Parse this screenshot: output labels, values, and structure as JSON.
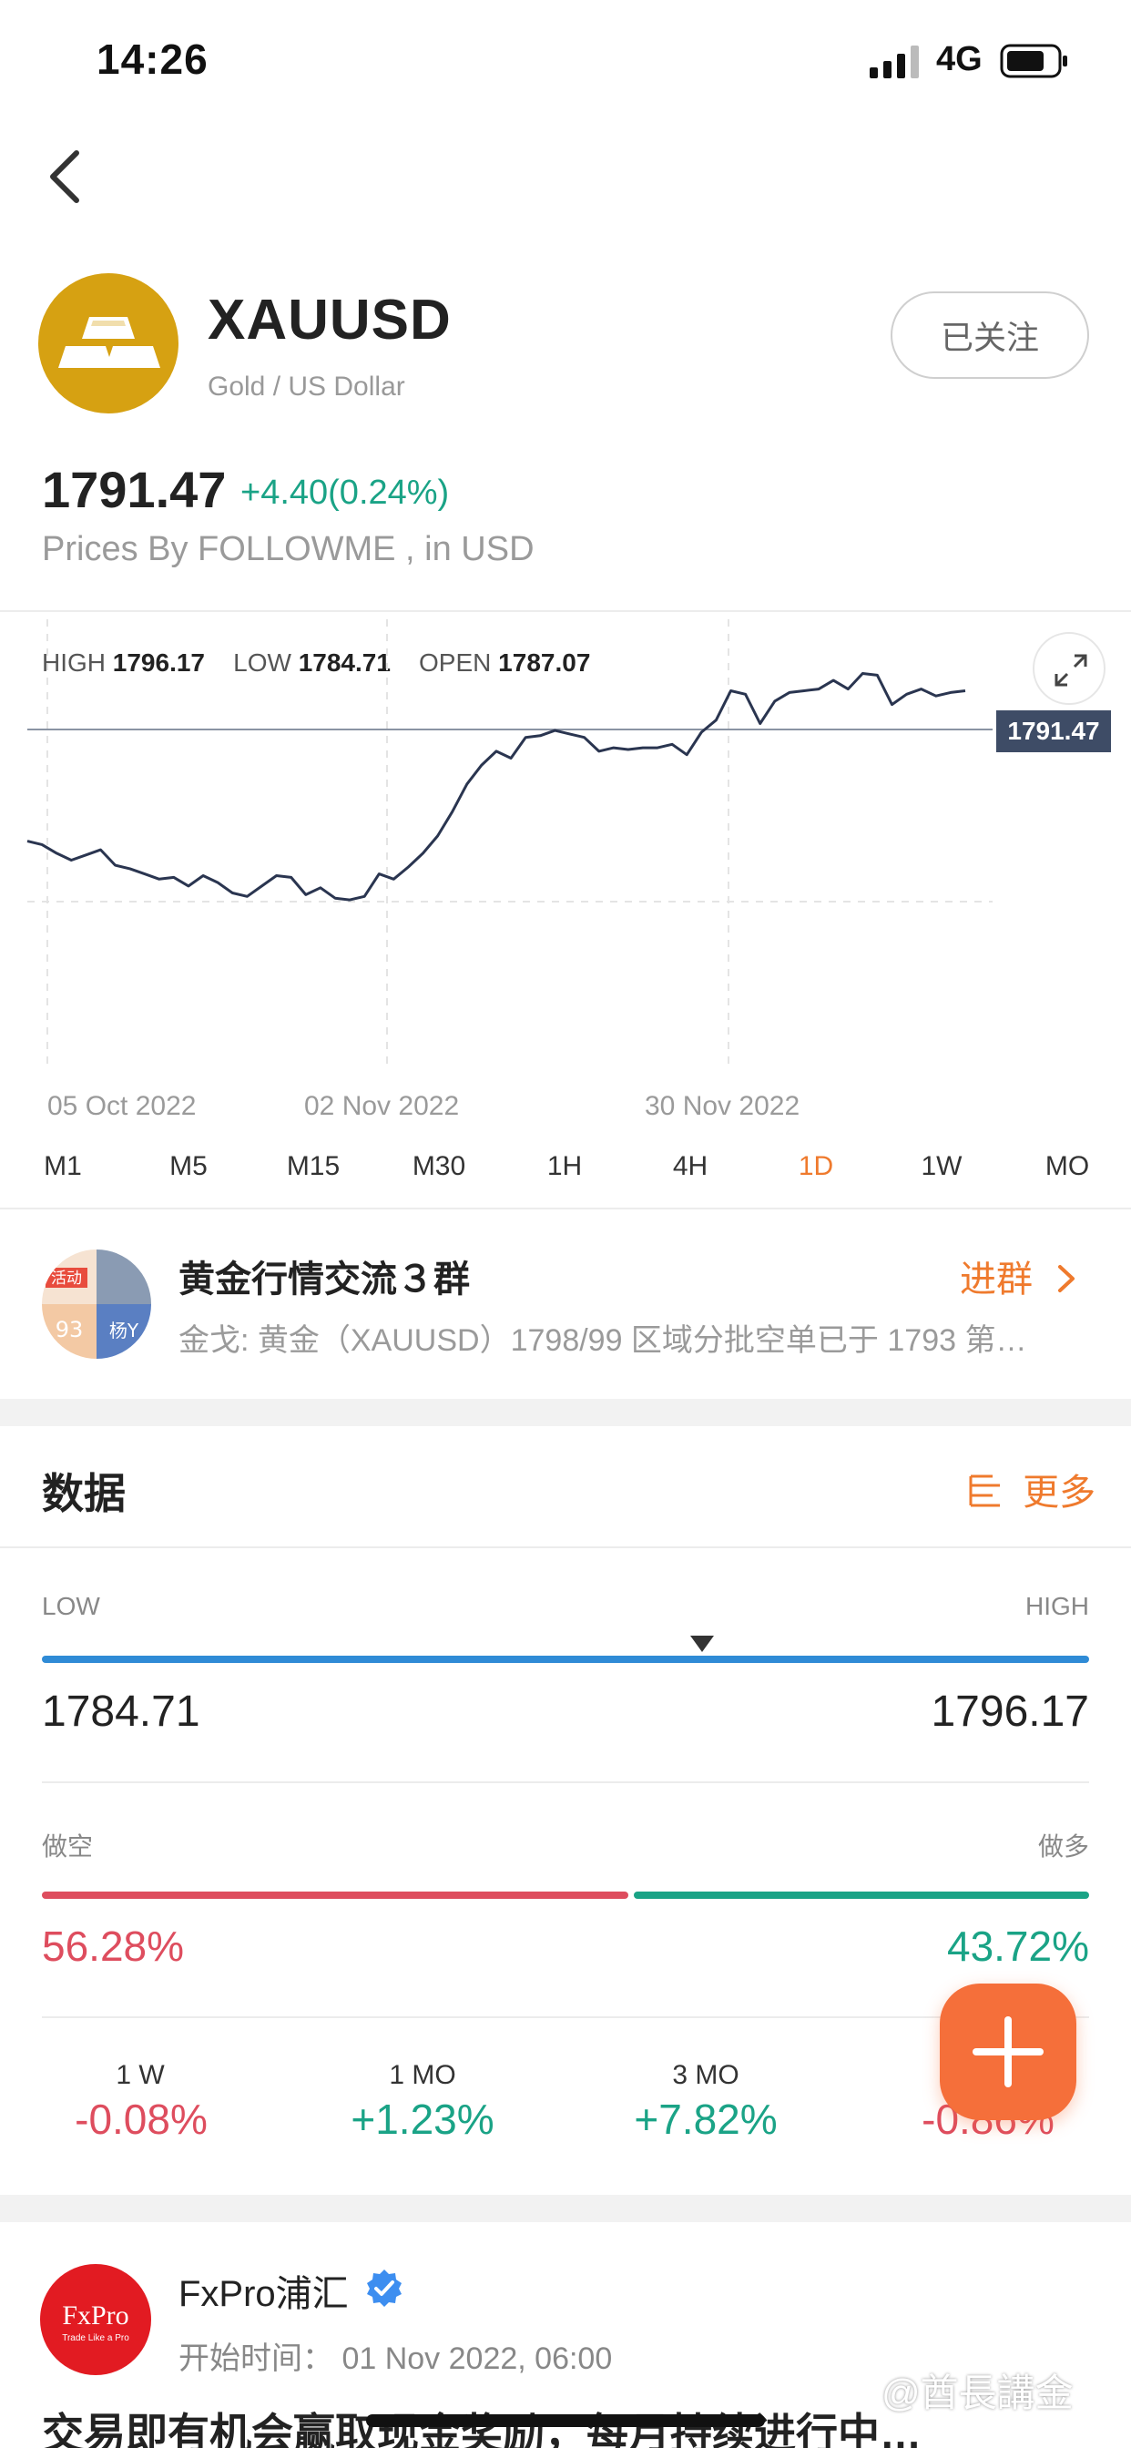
{
  "status_bar": {
    "time": "14:26",
    "network": "4G"
  },
  "header": {
    "symbol": "XAUUSD",
    "name": "Gold / US Dollar",
    "follow_label": "已关注",
    "price": "1791.47",
    "change": "+4.40(0.24%)",
    "source": "Prices By FOLLOWME , in USD",
    "logo_color": "#d6a112"
  },
  "chart_stats": {
    "high_label": "HIGH",
    "high_value": "1796.17",
    "low_label": "LOW",
    "low_value": "1784.71",
    "open_label": "OPEN",
    "open_value": "1787.07"
  },
  "chart_data": {
    "type": "line",
    "current_price_label": "1791.47",
    "x_tick_labels": [
      "05 Oct 2022",
      "02 Nov 2022",
      "30 Nov 2022"
    ],
    "series": [
      {
        "values": [
          1683,
          1681,
          1676,
          1672,
          1675,
          1678,
          1669,
          1667,
          1664,
          1661,
          1662,
          1657,
          1663,
          1659,
          1653,
          1651,
          1657,
          1663,
          1662,
          1652,
          1656,
          1650,
          1649,
          1651,
          1664,
          1661,
          1668,
          1676,
          1686,
          1700,
          1716,
          1727,
          1735,
          1731,
          1743,
          1744,
          1747,
          1745,
          1743,
          1735,
          1737,
          1736,
          1737,
          1737,
          1739,
          1733,
          1746,
          1753,
          1770,
          1768,
          1751,
          1764,
          1769,
          1770,
          1771,
          1776,
          1771,
          1780,
          1779,
          1762,
          1768,
          1771,
          1767,
          1769,
          1770
        ]
      }
    ],
    "grid": true,
    "line_color": "#2a3550"
  },
  "timeframes": {
    "items": [
      "M1",
      "M5",
      "M15",
      "M30",
      "1H",
      "4H",
      "1D",
      "1W",
      "MO"
    ],
    "active": "1D",
    "active_color": "#ef7a2d"
  },
  "group": {
    "title": "黄金行情交流３群",
    "subtitle": "金戈: 黄金（XAUUSD）1798/99 区域分批空单已于 1793 第…",
    "join_label": "进群",
    "avatar_texts": [
      "活动",
      "93",
      "杨Y"
    ]
  },
  "data_section": {
    "title": "数据",
    "more_label": "更多",
    "range": {
      "low_label": "LOW",
      "high_label": "HIGH",
      "low_value": "1784.71",
      "high_value": "1796.17",
      "position_fraction": 0.63
    },
    "sentiment": {
      "short_label": "做空",
      "long_label": "做多",
      "short_pct": "56.28%",
      "long_pct": "43.72%",
      "short_color": "#de4d5e",
      "long_color": "#1aa386"
    },
    "performance": [
      {
        "period": "1 W",
        "value": "-0.08%"
      },
      {
        "period": "1 MO",
        "value": "+1.23%"
      },
      {
        "period": "3 MO",
        "value": "+7.82%"
      },
      {
        "period": "",
        "value": "-0.86%"
      }
    ]
  },
  "news": {
    "logo_text": "FxPro",
    "logo_tagline": "Trade Like a Pro",
    "source": "FxPro浦汇",
    "time_label": "开始时间：",
    "time_value": "01 Nov 2022, 06:00",
    "headline": "交易即有机会赢取现金奖励，每月持续进行中…"
  },
  "watermark": "@酋長講金"
}
